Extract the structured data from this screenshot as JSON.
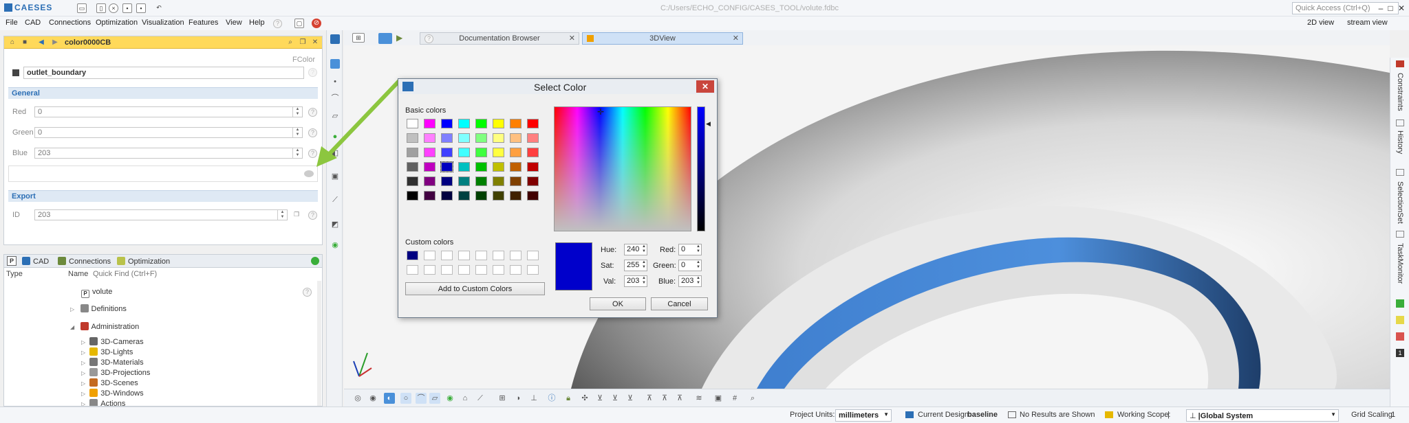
{
  "app": {
    "logo": "CAESES",
    "window_title": "C:/Users/ECHO_CONFIG/CASES_TOOL/volute.fdbc",
    "quick_access_placeholder": "Quick Access (Ctrl+Q)"
  },
  "menu": [
    {
      "label": "File"
    },
    {
      "label": "CAD"
    },
    {
      "label": "Connections"
    },
    {
      "label": "Optimization"
    },
    {
      "label": "Visualization"
    },
    {
      "label": "Features"
    },
    {
      "label": "View"
    },
    {
      "label": "Help"
    }
  ],
  "right_menu": {
    "view2d": "2D view",
    "stream": "stream view"
  },
  "props": {
    "object_name": "color0000CB",
    "type": "FColor",
    "name_value": "outlet_boundary",
    "general_section": "General",
    "red_label": "Red",
    "red_value": "0",
    "green_label": "Green",
    "green_value": "0",
    "blue_label": "Blue",
    "blue_value": "203",
    "export_section": "Export",
    "id_label": "ID",
    "id_value": "203"
  },
  "tree": {
    "tabs": [
      {
        "label": "CAD"
      },
      {
        "label": "Connections"
      },
      {
        "label": "Optimization"
      }
    ],
    "col_type": "Type",
    "col_name": "Name",
    "quick_find": "Quick Find (Ctrl+F)",
    "nodes": [
      {
        "label": "volute"
      },
      {
        "label": "Definitions"
      },
      {
        "label": "Administration"
      },
      {
        "label": "3D-Cameras"
      },
      {
        "label": "3D-Lights"
      },
      {
        "label": "3D-Materials"
      },
      {
        "label": "3D-Projections"
      },
      {
        "label": "3D-Scenes"
      },
      {
        "label": "3D-Windows"
      },
      {
        "label": "Actions"
      }
    ]
  },
  "view_tabs": [
    {
      "label": "Documentation Browser"
    },
    {
      "label": "3DView"
    }
  ],
  "right_panel": [
    {
      "label": "Constraints"
    },
    {
      "label": "History"
    },
    {
      "label": "SelectionSet"
    },
    {
      "label": "TaskMonitor"
    }
  ],
  "dialog": {
    "title": "Select Color",
    "basic_colors_label": "Basic colors",
    "custom_colors_label": "Custom colors",
    "add_custom": "Add to Custom Colors",
    "hue_label": "Hue:",
    "hue": "240",
    "sat_label": "Sat:",
    "sat": "255",
    "val_label": "Val:",
    "val": "203",
    "red_label": "Red:",
    "red": "0",
    "green_label": "Green:",
    "green": "0",
    "blue_label": "Blue:",
    "blue": "203",
    "ok": "OK",
    "cancel": "Cancel",
    "selected_color": "#0000cb",
    "basic_colors": [
      [
        "#ffffff",
        "#ff00ff",
        "#0000ff",
        "#00ffff",
        "#00ff00",
        "#ffff00",
        "#ff8000",
        "#ff0000"
      ],
      [
        "#c0c0c0",
        "#ff80ff",
        "#8080ff",
        "#80ffff",
        "#80ff80",
        "#ffff80",
        "#ffc080",
        "#ff8080"
      ],
      [
        "#a0a0a0",
        "#ff40ff",
        "#4040ff",
        "#40ffff",
        "#40ff40",
        "#ffff40",
        "#ffa040",
        "#ff4040"
      ],
      [
        "#606060",
        "#c000c0",
        "#0000c0",
        "#00c0c0",
        "#00c000",
        "#c0c000",
        "#c06000",
        "#c00000"
      ],
      [
        "#303030",
        "#800080",
        "#000080",
        "#008080",
        "#008000",
        "#808000",
        "#804000",
        "#800000"
      ],
      [
        "#000000",
        "#400040",
        "#000040",
        "#004040",
        "#004000",
        "#404000",
        "#402000",
        "#400000"
      ]
    ],
    "custom_colors": [
      "#000080"
    ]
  },
  "status": {
    "project_units_label": "Project Units:",
    "project_units": "millimeters",
    "design_label": "Current Design:",
    "design": "baseline",
    "results": "No Results are Shown",
    "scope_label": "Working Scope:",
    "scope": "|",
    "global_system": "|Global System",
    "scaling_label": "Grid Scaling:",
    "scaling": "1"
  }
}
